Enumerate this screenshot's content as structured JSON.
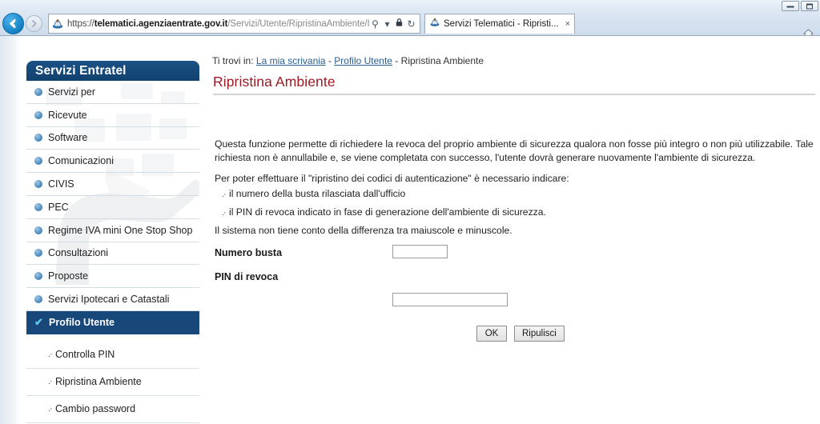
{
  "browser": {
    "url_scheme": "https://",
    "url_host": "telematici.agenziaentrate.gov.it",
    "url_path": "/Servizi/Utente/RipristinaAmbiente/IRipristinaAmbiente.js",
    "url_full": "https://telematici.agenziaentrate.gov.it/Servizi/Utente/RipristinaAmbiente/IRipristinaAmbiente.js",
    "tab_title": "Servizi Telematici - Ripristi...",
    "tab_close_label": "×",
    "back_label": "←",
    "forward_label": "→",
    "search_icon_label": "⚲",
    "dropdown_icon_label": "▾",
    "lock_icon_label": "🔒",
    "refresh_icon_label": "↻",
    "home_icon_label": "⌂"
  },
  "sidebar": {
    "header_title": "Servizi Entratel",
    "items": [
      {
        "label": "Servizi per",
        "selected": false
      },
      {
        "label": "Ricevute",
        "selected": false
      },
      {
        "label": "Software",
        "selected": false
      },
      {
        "label": "Comunicazioni",
        "selected": false
      },
      {
        "label": "CIVIS",
        "selected": false
      },
      {
        "label": "PEC",
        "selected": false
      },
      {
        "label": "Regime IVA mini One Stop Shop",
        "selected": false
      },
      {
        "label": "Consultazioni",
        "selected": false
      },
      {
        "label": "Proposte",
        "selected": false
      },
      {
        "label": "Servizi Ipotecari e Catastali",
        "selected": false
      },
      {
        "label": "Profilo Utente",
        "selected": true
      }
    ],
    "selected_check": "✔",
    "sub_items": [
      {
        "label": "Controlla PIN",
        "marker": ".·"
      },
      {
        "label": "Ripristina Ambiente",
        "marker": ".·"
      },
      {
        "label": "Cambio password",
        "marker": ".·"
      }
    ]
  },
  "breadcrumb": {
    "prefix": "Ti trovi in: ",
    "link1": "La mia scrivania",
    "sep1": " - ",
    "link2": "Profilo Utente",
    "sep2": " - ",
    "current": "Ripristina Ambiente"
  },
  "main": {
    "title": "Ripristina Ambiente",
    "paragraph1": "Questa funzione permette di richiedere la revoca del proprio ambiente di sicurezza qualora non fosse più integro o non più utilizzabile. Tale richiesta non è annullabile e, se viene completata con successo, l'utente dovrà generare nuovamente l'ambiente di sicurezza.",
    "paragraph2": "Per poter effettuare il \"ripristino dei codici di autenticazione\" è necessario indicare:",
    "bullets": [
      {
        "marker": ".·",
        "text": "il numero della busta rilasciata dall'ufficio"
      },
      {
        "marker": ".·",
        "text": "il PIN di revoca indicato in fase di generazione dell'ambiente di sicurezza."
      }
    ],
    "paragraph3": "Il sistema non tiene conto della differenza tra maiuscole e minuscole."
  },
  "form": {
    "fields": [
      {
        "label": "Numero busta",
        "value": "",
        "placeholder": ""
      },
      {
        "label": "PIN di revoca",
        "value": "",
        "placeholder": ""
      }
    ],
    "submit_label": "OK",
    "reset_label": "Ripulisci"
  },
  "colors": {
    "sidebar_header": "#11416e",
    "sidebar_selected": "#18477a",
    "title_red": "#9c1b24",
    "link_blue": "#2b5e8e",
    "back_button": "#1380c4"
  }
}
